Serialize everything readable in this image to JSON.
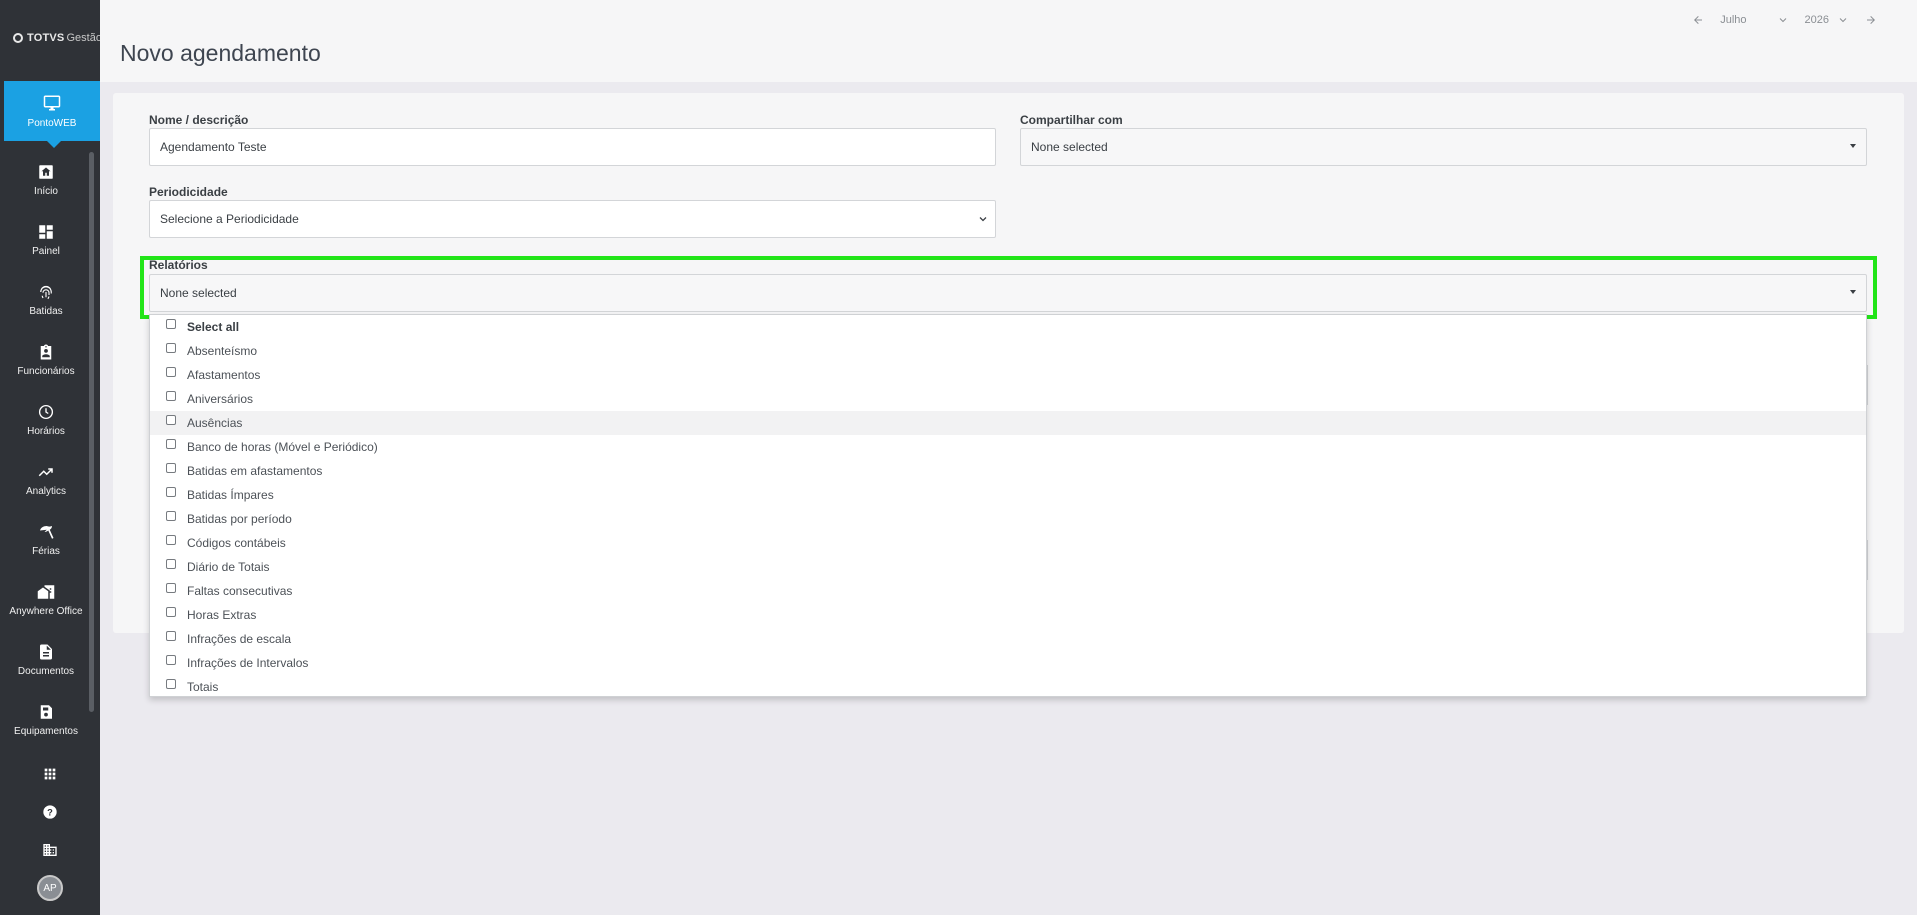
{
  "sidebar": {
    "logo_brand": "TOTVS",
    "logo_suffix": "Gestão",
    "active": {
      "label": "PontoWEB",
      "icon": "monitor-icon"
    },
    "items": [
      {
        "label": "Início",
        "icon": "home-icon"
      },
      {
        "label": "Painel",
        "icon": "dashboard-icon"
      },
      {
        "label": "Batidas",
        "icon": "fingerprint-icon"
      },
      {
        "label": "Funcionários",
        "icon": "badge-icon"
      },
      {
        "label": "Horários",
        "icon": "clock-icon"
      },
      {
        "label": "Analytics",
        "icon": "trending-up-icon"
      },
      {
        "label": "Férias",
        "icon": "beach-umbrella-icon"
      },
      {
        "label": "Anywhere Office",
        "icon": "home-work-icon"
      },
      {
        "label": "Documentos",
        "icon": "document-icon"
      },
      {
        "label": "Equipamentos",
        "icon": "device-icon"
      }
    ],
    "bottom": {
      "apps_icon": "grid-icon",
      "help_icon": "help-icon",
      "company_icon": "building-icon",
      "avatar_initials": "AP"
    }
  },
  "header": {
    "title": "Novo agendamento",
    "month": "Julho",
    "year": "2026"
  },
  "form": {
    "nome_label": "Nome / descrição",
    "nome_value": "Agendamento Teste",
    "compartilhar_label": "Compartilhar com",
    "compartilhar_value": "None selected",
    "periodicidade_label": "Periodicidade",
    "periodicidade_value": "Selecione a Periodicidade",
    "relatorios_label": "Relatórios",
    "relatorios_value": "None selected"
  },
  "dropdown": {
    "options": [
      {
        "label": "Select all",
        "bold": true
      },
      {
        "label": "Absenteísmo"
      },
      {
        "label": "Afastamentos"
      },
      {
        "label": "Aniversários"
      },
      {
        "label": "Ausências",
        "hover": true
      },
      {
        "label": "Banco de horas (Móvel e Periódico)"
      },
      {
        "label": "Batidas em afastamentos"
      },
      {
        "label": "Batidas Ímpares"
      },
      {
        "label": "Batidas por período"
      },
      {
        "label": "Códigos contábeis"
      },
      {
        "label": "Diário de Totais"
      },
      {
        "label": "Faltas consecutivas"
      },
      {
        "label": "Horas Extras"
      },
      {
        "label": "Infrações de escala"
      },
      {
        "label": "Infrações de Intervalos"
      },
      {
        "label": "Totais"
      }
    ]
  },
  "colors": {
    "sidebar_bg": "#2f3237",
    "accent": "#1ba1e3",
    "highlight": "#22e518"
  }
}
